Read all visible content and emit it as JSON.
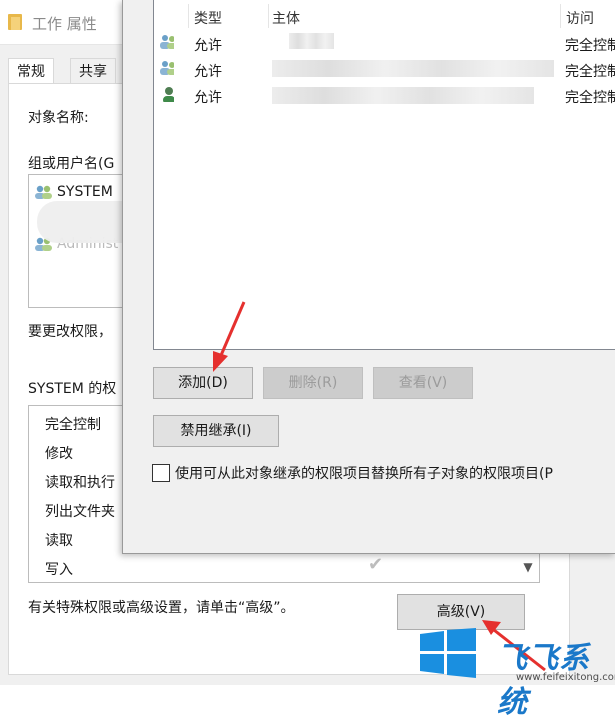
{
  "back_window": {
    "title": "工作 属性",
    "tabs": [
      "常规",
      "共享"
    ],
    "object_name_label": "对象名称:",
    "group_label": "组或用户名(G",
    "groups": [
      "SYSTEM",
      "Administ"
    ],
    "change_perm_text": "要更改权限，",
    "perm_header": "SYSTEM 的权",
    "perms": [
      "完全控制",
      "修改",
      "读取和执行",
      "列出文件夹",
      "读取",
      "写入"
    ],
    "special_text": "有关特殊权限或高级设置，请单击“高级”。",
    "advanced_button": "高级(V)"
  },
  "front_window": {
    "columns": {
      "type": "类型",
      "principal": "主体",
      "access": "访问"
    },
    "entries": [
      {
        "type": "允许",
        "access": "完全控制"
      },
      {
        "type": "允许",
        "access": "完全控制"
      },
      {
        "type": "允许",
        "access": "完全控制"
      }
    ],
    "buttons": {
      "add": "添加(D)",
      "remove": "删除(R)",
      "view": "查看(V)",
      "disable_inherit": "禁用继承(I)"
    },
    "checkbox_label": "使用可从此对象继承的权限项目替换所有子对象的权限项目(P"
  },
  "watermark": {
    "text": "飞飞系统",
    "url": "www.feifeixitong.com"
  },
  "colors": {
    "accent": "#e5302e",
    "brand": "#1a78c9"
  }
}
